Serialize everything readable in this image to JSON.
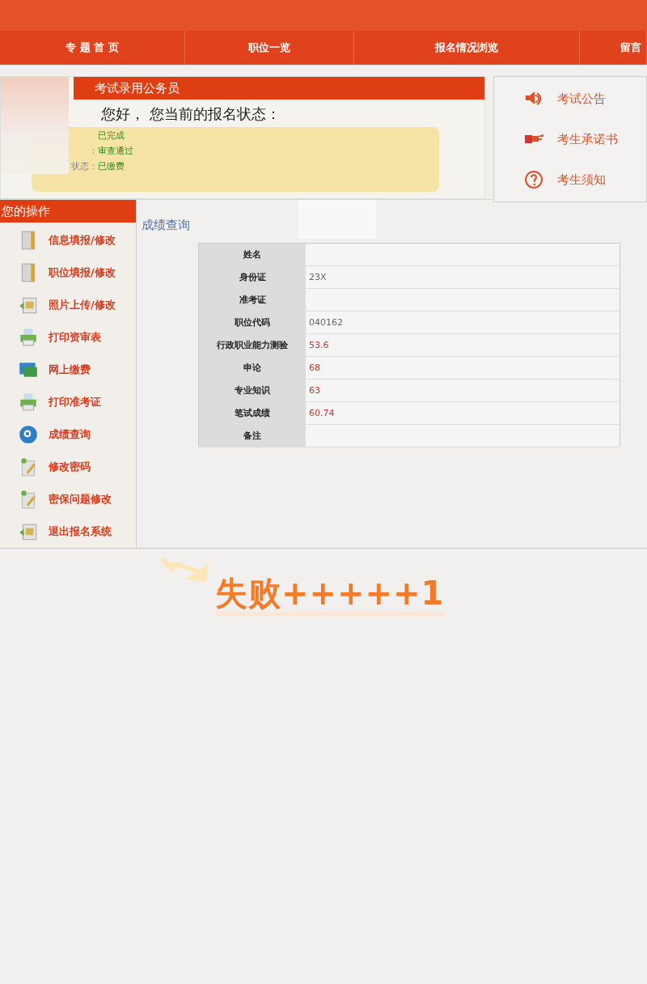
{
  "nav": [
    {
      "label": "专 题 首 页"
    },
    {
      "label": "职位一览"
    },
    {
      "label": "报名情况浏览"
    },
    {
      "label": "留言"
    }
  ],
  "status_panel": {
    "title": "考试录用公务员",
    "greeting": "您好， 您当前的报名状态：",
    "items": [
      {
        "value": "已完成"
      },
      {
        "label": "：",
        "value": "审查通过"
      },
      {
        "label": "状态：",
        "value": "已缴费"
      }
    ]
  },
  "quick_links": [
    {
      "kind": "speaker",
      "label": "考试公告"
    },
    {
      "kind": "hand",
      "label": "考生承诺书"
    },
    {
      "kind": "question",
      "label": "考生须知"
    }
  ],
  "sidebar": {
    "title": "您的操作",
    "items": [
      {
        "kind": "book",
        "label": "信息填报/修改"
      },
      {
        "kind": "book",
        "label": "职位填报/修改"
      },
      {
        "kind": "photo",
        "label": "照片上传/修改"
      },
      {
        "kind": "printer",
        "label": "打印资审表"
      },
      {
        "kind": "card",
        "label": "网上缴费"
      },
      {
        "kind": "printer",
        "label": "打印准考证"
      },
      {
        "kind": "search",
        "label": "成绩查询"
      },
      {
        "kind": "edit",
        "label": "修改密码"
      },
      {
        "kind": "edit",
        "label": "密保问题修改"
      },
      {
        "kind": "photo",
        "label": "退出报名系统"
      }
    ]
  },
  "scores": {
    "title": "成绩查询",
    "rows": [
      {
        "label": "姓名"
      },
      {
        "label": "身份证",
        "kind": "info",
        "value": "23X"
      },
      {
        "label": "准考证"
      },
      {
        "label": "职位代码",
        "kind": "info",
        "value": "040162"
      },
      {
        "label": "行政职业能力测验",
        "kind": "score",
        "value": "53.6"
      },
      {
        "label": "申论",
        "kind": "score",
        "value": "68"
      },
      {
        "label": "专业知识",
        "kind": "score",
        "value": "63"
      },
      {
        "label": "笔试成绩",
        "kind": "score",
        "value": "60.74"
      },
      {
        "label": "备注"
      }
    ]
  },
  "annotation": {
    "text": "失败+++++1"
  }
}
